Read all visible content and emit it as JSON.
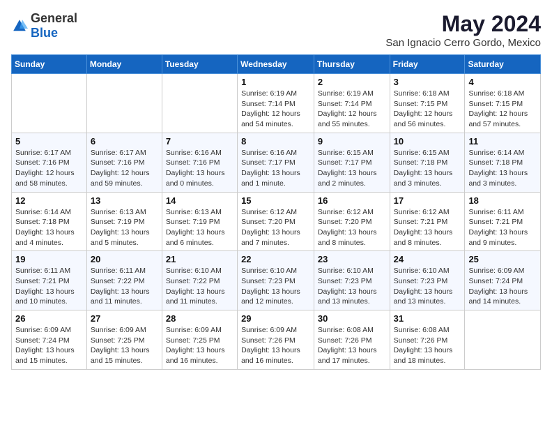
{
  "header": {
    "logo_general": "General",
    "logo_blue": "Blue",
    "month_year": "May 2024",
    "location": "San Ignacio Cerro Gordo, Mexico"
  },
  "days_of_week": [
    "Sunday",
    "Monday",
    "Tuesday",
    "Wednesday",
    "Thursday",
    "Friday",
    "Saturday"
  ],
  "weeks": [
    [
      {
        "day": "",
        "info": ""
      },
      {
        "day": "",
        "info": ""
      },
      {
        "day": "",
        "info": ""
      },
      {
        "day": "1",
        "sunrise": "6:19 AM",
        "sunset": "7:14 PM",
        "daylight": "12 hours and 54 minutes."
      },
      {
        "day": "2",
        "sunrise": "6:19 AM",
        "sunset": "7:14 PM",
        "daylight": "12 hours and 55 minutes."
      },
      {
        "day": "3",
        "sunrise": "6:18 AM",
        "sunset": "7:15 PM",
        "daylight": "12 hours and 56 minutes."
      },
      {
        "day": "4",
        "sunrise": "6:18 AM",
        "sunset": "7:15 PM",
        "daylight": "12 hours and 57 minutes."
      }
    ],
    [
      {
        "day": "5",
        "sunrise": "6:17 AM",
        "sunset": "7:16 PM",
        "daylight": "12 hours and 58 minutes."
      },
      {
        "day": "6",
        "sunrise": "6:17 AM",
        "sunset": "7:16 PM",
        "daylight": "12 hours and 59 minutes."
      },
      {
        "day": "7",
        "sunrise": "6:16 AM",
        "sunset": "7:16 PM",
        "daylight": "13 hours and 0 minutes."
      },
      {
        "day": "8",
        "sunrise": "6:16 AM",
        "sunset": "7:17 PM",
        "daylight": "13 hours and 1 minute."
      },
      {
        "day": "9",
        "sunrise": "6:15 AM",
        "sunset": "7:17 PM",
        "daylight": "13 hours and 2 minutes."
      },
      {
        "day": "10",
        "sunrise": "6:15 AM",
        "sunset": "7:18 PM",
        "daylight": "13 hours and 3 minutes."
      },
      {
        "day": "11",
        "sunrise": "6:14 AM",
        "sunset": "7:18 PM",
        "daylight": "13 hours and 3 minutes."
      }
    ],
    [
      {
        "day": "12",
        "sunrise": "6:14 AM",
        "sunset": "7:18 PM",
        "daylight": "13 hours and 4 minutes."
      },
      {
        "day": "13",
        "sunrise": "6:13 AM",
        "sunset": "7:19 PM",
        "daylight": "13 hours and 5 minutes."
      },
      {
        "day": "14",
        "sunrise": "6:13 AM",
        "sunset": "7:19 PM",
        "daylight": "13 hours and 6 minutes."
      },
      {
        "day": "15",
        "sunrise": "6:12 AM",
        "sunset": "7:20 PM",
        "daylight": "13 hours and 7 minutes."
      },
      {
        "day": "16",
        "sunrise": "6:12 AM",
        "sunset": "7:20 PM",
        "daylight": "13 hours and 8 minutes."
      },
      {
        "day": "17",
        "sunrise": "6:12 AM",
        "sunset": "7:21 PM",
        "daylight": "13 hours and 8 minutes."
      },
      {
        "day": "18",
        "sunrise": "6:11 AM",
        "sunset": "7:21 PM",
        "daylight": "13 hours and 9 minutes."
      }
    ],
    [
      {
        "day": "19",
        "sunrise": "6:11 AM",
        "sunset": "7:21 PM",
        "daylight": "13 hours and 10 minutes."
      },
      {
        "day": "20",
        "sunrise": "6:11 AM",
        "sunset": "7:22 PM",
        "daylight": "13 hours and 11 minutes."
      },
      {
        "day": "21",
        "sunrise": "6:10 AM",
        "sunset": "7:22 PM",
        "daylight": "13 hours and 11 minutes."
      },
      {
        "day": "22",
        "sunrise": "6:10 AM",
        "sunset": "7:23 PM",
        "daylight": "13 hours and 12 minutes."
      },
      {
        "day": "23",
        "sunrise": "6:10 AM",
        "sunset": "7:23 PM",
        "daylight": "13 hours and 13 minutes."
      },
      {
        "day": "24",
        "sunrise": "6:10 AM",
        "sunset": "7:23 PM",
        "daylight": "13 hours and 13 minutes."
      },
      {
        "day": "25",
        "sunrise": "6:09 AM",
        "sunset": "7:24 PM",
        "daylight": "13 hours and 14 minutes."
      }
    ],
    [
      {
        "day": "26",
        "sunrise": "6:09 AM",
        "sunset": "7:24 PM",
        "daylight": "13 hours and 15 minutes."
      },
      {
        "day": "27",
        "sunrise": "6:09 AM",
        "sunset": "7:25 PM",
        "daylight": "13 hours and 15 minutes."
      },
      {
        "day": "28",
        "sunrise": "6:09 AM",
        "sunset": "7:25 PM",
        "daylight": "13 hours and 16 minutes."
      },
      {
        "day": "29",
        "sunrise": "6:09 AM",
        "sunset": "7:26 PM",
        "daylight": "13 hours and 16 minutes."
      },
      {
        "day": "30",
        "sunrise": "6:08 AM",
        "sunset": "7:26 PM",
        "daylight": "13 hours and 17 minutes."
      },
      {
        "day": "31",
        "sunrise": "6:08 AM",
        "sunset": "7:26 PM",
        "daylight": "13 hours and 18 minutes."
      },
      {
        "day": "",
        "info": ""
      }
    ]
  ]
}
